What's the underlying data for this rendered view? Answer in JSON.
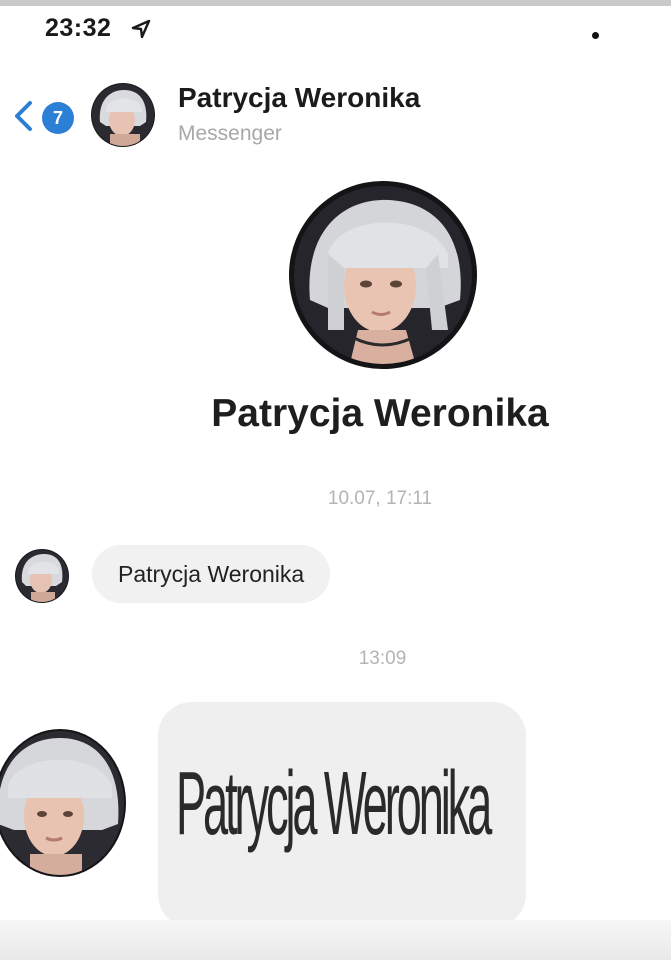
{
  "status_bar": {
    "time": "23:32",
    "location_icon": "location-arrow-icon"
  },
  "header": {
    "back_icon": "chevron-left-icon",
    "unread_count": "7",
    "contact_name": "Patrycja Weronika",
    "app_subtitle": "Messenger"
  },
  "profile": {
    "name": "Patrycja Weronika"
  },
  "conversation": {
    "messages": [
      {
        "timestamp": "10.07, 17:11",
        "text": "Patrycja Weronika"
      },
      {
        "timestamp": "13:09",
        "text": "Patrycja Weronika"
      }
    ]
  },
  "colors": {
    "badge": "#2b7fd4",
    "back_chevron": "#2b7fd4",
    "bubble": "#f1f1f1",
    "timestamp": "#b4b4b4",
    "subtitle": "#a8a8a8"
  }
}
